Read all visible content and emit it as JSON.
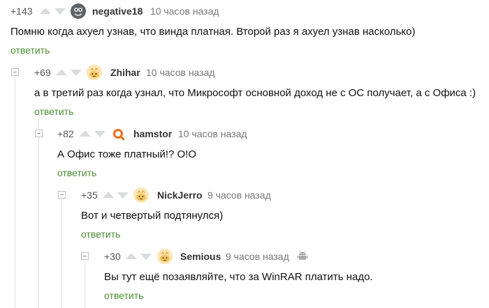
{
  "comments": [
    {
      "rating": "+143",
      "author": "negative18",
      "time": "10 часов назад",
      "text": "Помню когда ахуел узнав, что винда платная. Второй раз я ахуел узнав насколько)",
      "reply": "ответить",
      "avatar": "gray-avatar-icon"
    },
    {
      "rating": "+69",
      "author": "Zhihar",
      "time": "10 часов назад",
      "text": "а в третий раз когда узнал, что Микрософт основной доход не с ОС получает, а с Офиса :)",
      "reply": "ответить",
      "avatar": "default-avatar-icon"
    },
    {
      "rating": "+82",
      "author": "hamstor",
      "time": "10 часов назад",
      "text": "А Офис тоже платный!? О!О",
      "reply": "ответить",
      "avatar": "orange-avatar-icon"
    },
    {
      "rating": "+35",
      "author": "NickJerro",
      "time": "9 часов назад",
      "text": "Вот и четвертый подтянулся)",
      "reply": "ответить",
      "avatar": "default-avatar-icon"
    },
    {
      "rating": "+30",
      "author": "Semious",
      "time": "9 часов назад",
      "text": "Вы тут ещё позаявляйте, что за WinRAR платить надо.",
      "reply": "ответить",
      "avatar": "default-avatar-icon",
      "device": "android-icon"
    }
  ],
  "colors": {
    "reply": "#4e8e33",
    "arrows": "#d8dcdf",
    "thread_line": "#dfe3e6",
    "text": "#111111"
  }
}
